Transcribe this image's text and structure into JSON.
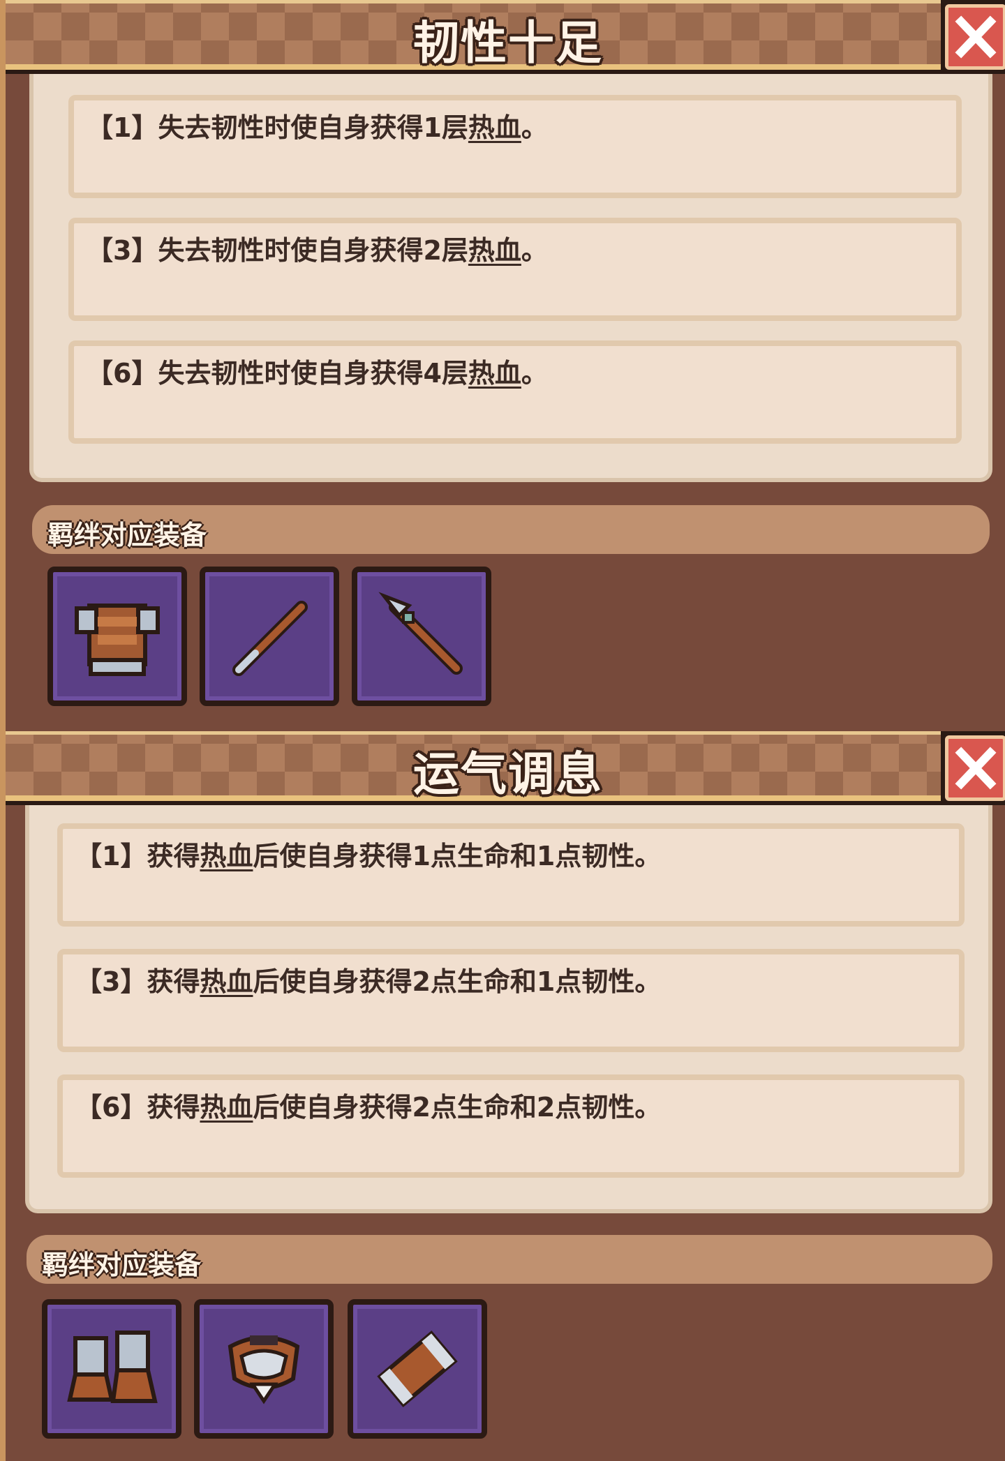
{
  "panels": [
    {
      "title": "韧性十足",
      "tiers": [
        {
          "prefix": "【1】失去韧性时使自身获得1层",
          "keyword": "热血",
          "suffix": "。"
        },
        {
          "prefix": "【3】失去韧性时使自身获得2层",
          "keyword": "热血",
          "suffix": "。"
        },
        {
          "prefix": "【6】失去韧性时使自身获得4层",
          "keyword": "热血",
          "suffix": "。"
        }
      ],
      "equip_header": "羁绊对应装备",
      "equipment": [
        "armor-icon",
        "staff-icon",
        "spear-icon"
      ]
    },
    {
      "title": "运气调息",
      "tiers": [
        {
          "prefix": "【1】获得",
          "keyword": "热血",
          "suffix": "后使自身获得1点生命和1点韧性。"
        },
        {
          "prefix": "【3】获得",
          "keyword": "热血",
          "suffix": "后使自身获得2点生命和1点韧性。"
        },
        {
          "prefix": "【6】获得",
          "keyword": "热血",
          "suffix": "后使自身获得2点生命和2点韧性。"
        }
      ],
      "equip_header": "羁绊对应装备",
      "equipment": [
        "boots-icon",
        "collar-icon",
        "bracer-icon"
      ]
    }
  ],
  "colors": {
    "panel_bg": "#774a3b",
    "desc_bg": "#ecdccb",
    "slot_bg": "#5b3f86",
    "close_red": "#d9574f"
  }
}
